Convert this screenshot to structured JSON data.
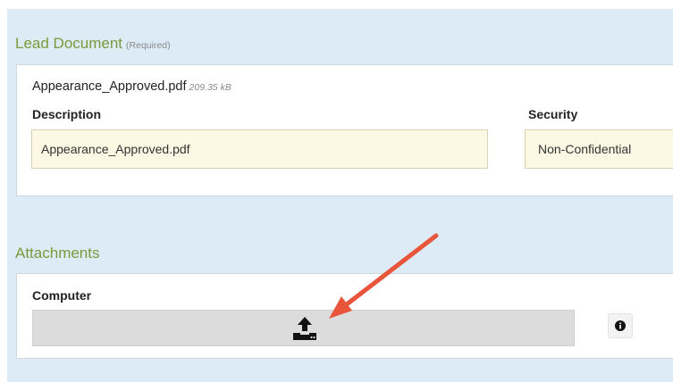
{
  "lead_document": {
    "title": "Lead Document",
    "required_note": "(Required)",
    "file_name": "Appearance_Approved.pdf",
    "file_size": "209.35 kB",
    "description_label": "Description",
    "description_value": "Appearance_Approved.pdf",
    "security_label": "Security",
    "security_value": "Non-Confidential"
  },
  "attachments": {
    "title": "Attachments",
    "source_label": "Computer",
    "upload_icon": "upload-icon",
    "info_icon": "info-icon"
  },
  "annotation": {
    "arrow_color": "#e8553a"
  },
  "colors": {
    "panel_background": "#dcebf6",
    "section_title": "#7a9a3a",
    "input_background": "#fcf8e3",
    "upload_bar": "#dcdcdc"
  }
}
